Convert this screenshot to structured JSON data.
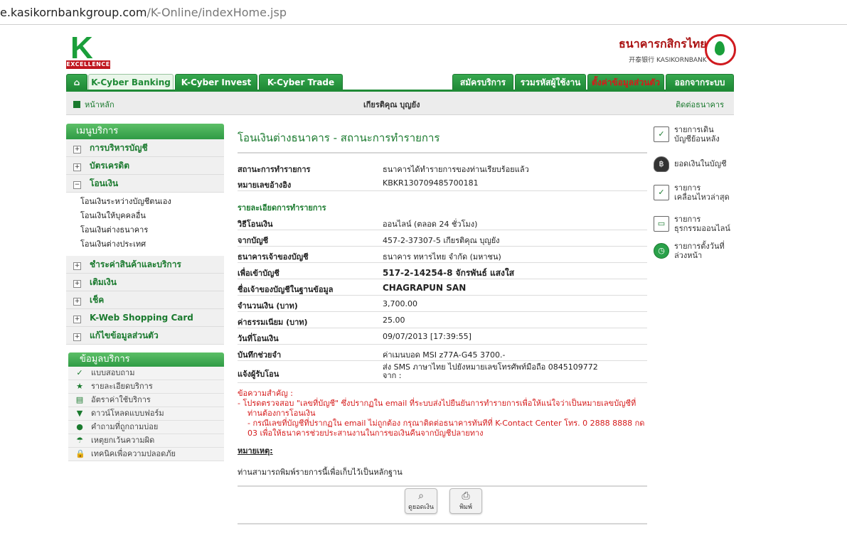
{
  "browser": {
    "url_host": "e.kasikornbankgroup.com",
    "url_path": "/K-Online/indexHome.jsp"
  },
  "brand": {
    "logo_letter": "K",
    "logo_tag": "EXCELLENCE",
    "bank_name_th": "ธนาคารกสิกรไทย",
    "bank_name_en": "开泰银行 KASIKORNBANK"
  },
  "nav": {
    "tabs": [
      "K-Cyber Banking",
      "K-Cyber Invest",
      "K-Cyber Trade"
    ],
    "right_tabs": [
      "สมัครบริการ",
      "รวมรหัสผู้ใช้งาน",
      "ตั้งค่าข้อมูลส่วนตัว",
      "ออกจากระบบ"
    ]
  },
  "subbar": {
    "home": "หน้าหลัก",
    "user": "เกียรติคุณ บุญยัง",
    "contact": "ติดต่อธนาคาร"
  },
  "menu": {
    "title": "เมนูบริการ",
    "items": [
      "การบริหารบัญชี",
      "บัตรเครดิต",
      "โอนเงิน"
    ],
    "subitems": [
      "โอนเงินระหว่างบัญชีตนเอง",
      "โอนเงินให้บุคคลอื่น",
      "โอนเงินต่างธนาคาร",
      "โอนเงินต่างประเทศ"
    ],
    "items2": [
      "ชำระค่าสินค้าและบริการ",
      "เติมเงิน",
      "เช็ค",
      "K-Web Shopping Card",
      "แก้ไขข้อมูลส่วนตัว"
    ],
    "plus": "+",
    "minus": "−"
  },
  "info": {
    "title": "ข้อมูลบริการ",
    "rows": [
      "แบบสอบถาม",
      "รายละเอียดบริการ",
      "อัตราค่าใช้บริการ",
      "ดาวน์โหลดแบบฟอร์ม",
      "คำถามที่ถูกถามบ่อย",
      "เหตุยกเว้นความผิด",
      "เทคนิคเพื่อความปลอดภัย"
    ],
    "icons": [
      "✓",
      "★",
      "▤",
      "▼",
      "●",
      "☂",
      "🔒"
    ]
  },
  "main": {
    "title": "โอนเงินต่างธนาคาร - สถานะการทำรายการ",
    "status_label": "สถานะการทำรายการ",
    "status_value": "ธนาคารได้ทำรายการของท่านเรียบร้อยแล้ว",
    "ref_label": "หมายเลขอ้างอิง",
    "ref_value": "KBKR130709485700181",
    "detail_header": "รายละเอียดการทำรายการ",
    "fields": [
      {
        "k": "วิธีโอนเงิน",
        "v": "ออนไลน์ (ตลอด 24 ชั่วโมง)"
      },
      {
        "k": "จากบัญชี",
        "v": "457-2-37307-5 เกียรติคุณ บุญยัง"
      },
      {
        "k": "ธนาคารเจ้าของบัญชี",
        "v": "ธนาคาร ทหารไทย จำกัด (มหาชน)"
      },
      {
        "k": "เพื่อเข้าบัญชี",
        "v": "517-2-14254-8 จักรพันธ์ แสงใส"
      },
      {
        "k": "ชื่อเจ้าของบัญชีในฐานข้อมูล",
        "v": "CHAGRAPUN SAN"
      },
      {
        "k": "จำนวนเงิน (บาท)",
        "v": "3,700.00"
      },
      {
        "k": "ค่าธรรมเนียม (บาท)",
        "v": "25.00"
      },
      {
        "k": "วันที่โอนเงิน",
        "v": "09/07/2013 [17:39:55]"
      },
      {
        "k": "บันทึกช่วยจำ",
        "v": "ค่าเมนบอด MSI z77A-G45 3700.-"
      }
    ],
    "notify_label": "แจ้งผู้รับโอน",
    "notify_value": "ส่ง SMS ภาษาไทย ไปยังหมายเลขโทรศัพท์มือถือ 0845109772",
    "notify_value2": "จาก :",
    "warn_title": "ข้อความสำคัญ :",
    "warn1": "- โปรดตรวจสอบ \"เลขที่บัญชี\" ซึ่งปรากฏใน email ที่ระบบส่งไปยืนยันการทำรายการเพื่อให้แน่ใจว่าเป็นหมายเลขบัญชีที่ท่านต้องการโอนเงิน",
    "warn2": "- กรณีเลขที่บัญชีที่ปรากฏใน email ไม่ถูกต้อง กรุณาติดต่อธนาคารทันทีที่ K-Contact Center โทร. 0 2888 8888 กด 03 เพื่อให้ธนาคารช่วยประสานงานในการขอเงินคืนจากบัญชีปลายทาง",
    "note_label": "หมายเหตุ:",
    "note_text": "ท่านสามารถพิมพ์รายการนี้เพื่อเก็บไว้เป็นหลักฐาน",
    "btn_balance": "ดูยอดเงิน",
    "btn_print": "พิมพ์"
  },
  "side": {
    "items": [
      {
        "l1": "รายการเดิน",
        "l2": "บัญชีย้อนหลัง"
      },
      {
        "l1": "ยอดเงินในบัญชี",
        "l2": ""
      },
      {
        "l1": "รายการ",
        "l2": "เคลื่อนไหวล่าสุด"
      },
      {
        "l1": "รายการ",
        "l2": "ธุรกรรมออนไลน์"
      },
      {
        "l1": "รายการตั้งวันที่",
        "l2": "ล่วงหน้า"
      }
    ],
    "icons": [
      "✓",
      "฿",
      "✓",
      "▭",
      "◷"
    ]
  }
}
